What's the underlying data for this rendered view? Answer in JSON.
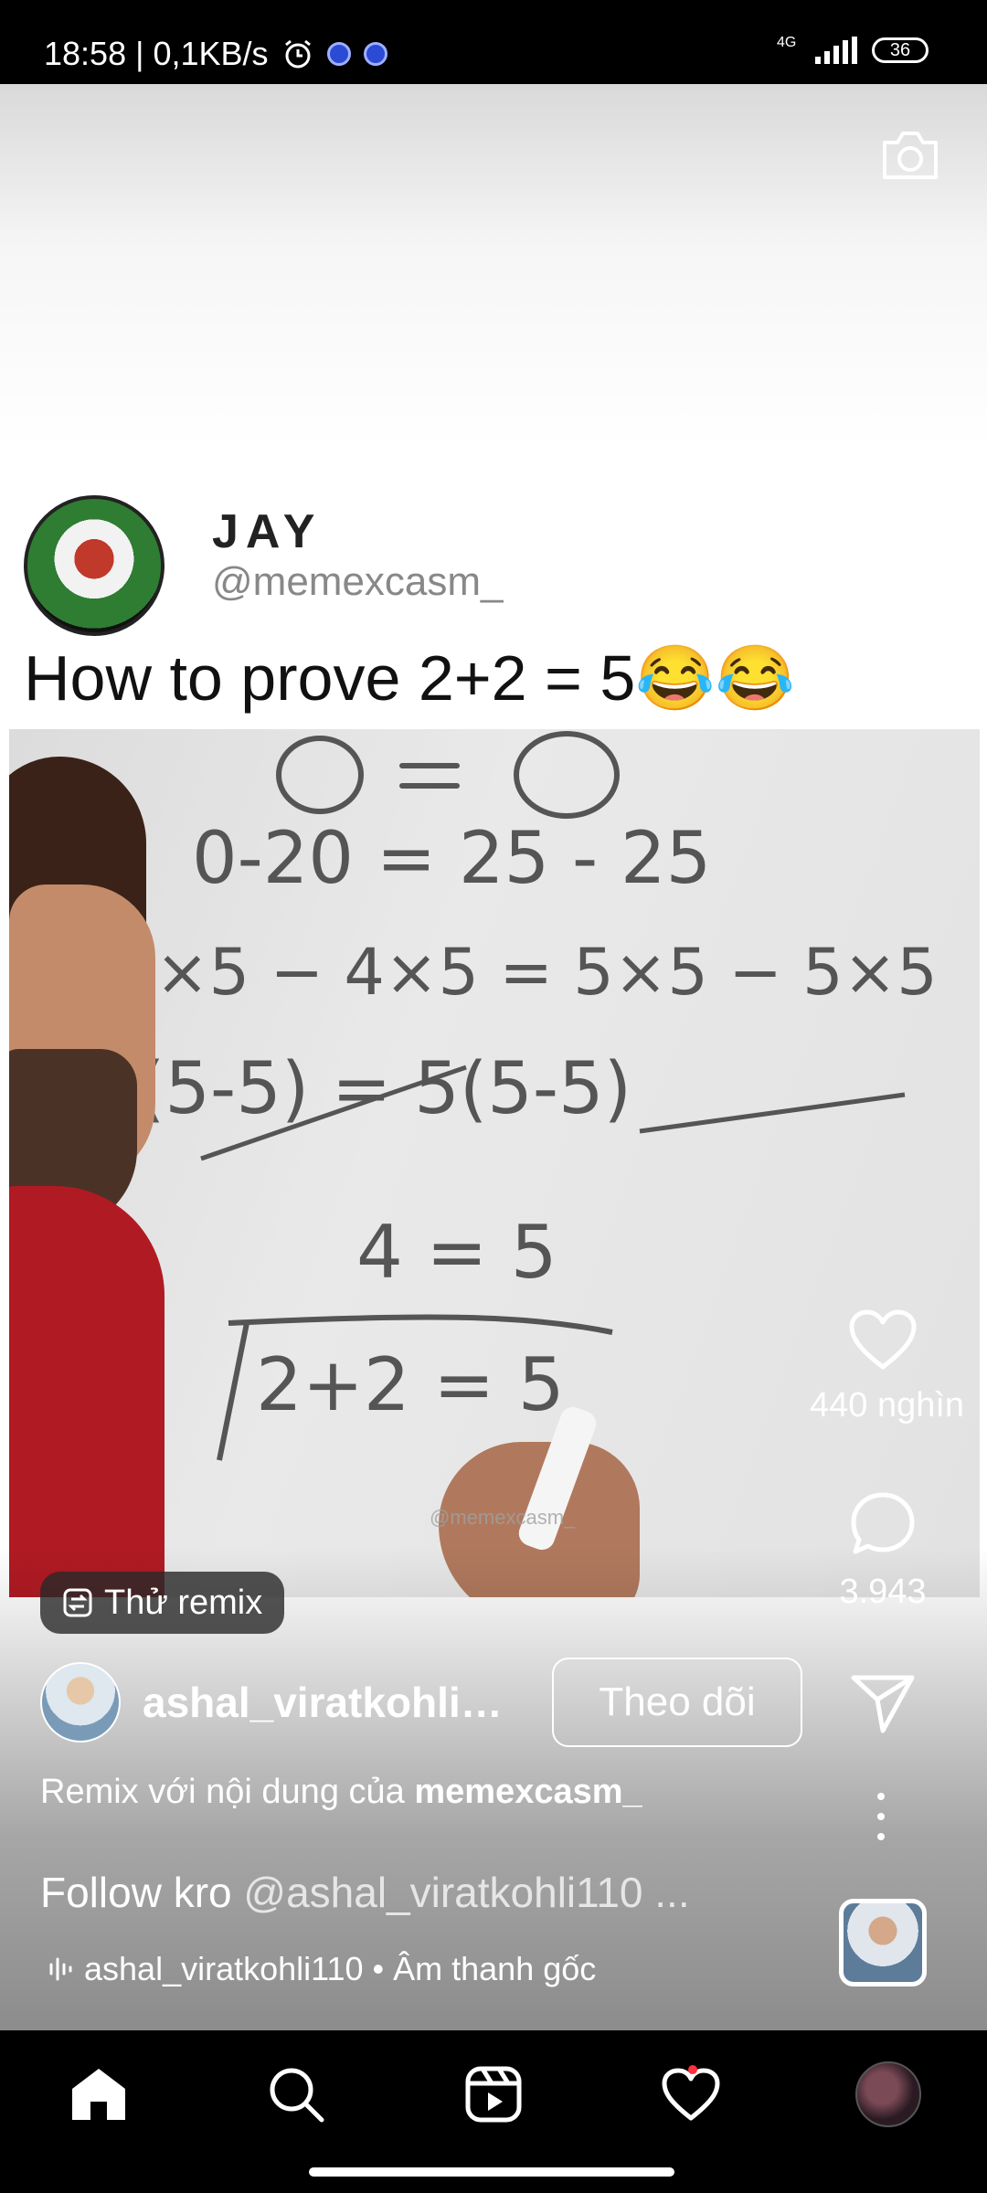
{
  "status_bar": {
    "time_speed": "18:58 | 0,1KB/s",
    "network": "4G",
    "battery": "36"
  },
  "post": {
    "name": "JAY",
    "handle": "@memexcasm_",
    "caption": "How to prove 2+2 = 5😂😂",
    "watermark": "@memexcasm_"
  },
  "whiteboard_lines": [
    "0 = 0",
    "20-20 = 25-25",
    "4×5 − 4×5 = 5×5 − 5×5",
    "4(5-5) = 5(5-5)",
    "4 = 5",
    "2+2 = 5"
  ],
  "actions": {
    "likes": "440 nghìn",
    "comments": "3.943"
  },
  "remix_chip": "Thử remix",
  "author": {
    "username": "ashal_viratkohli110",
    "follow_label": "Theo dõi"
  },
  "remix_line": {
    "prefix": "Remix với nội dung của ",
    "source": "memexcasm_"
  },
  "caption_line": {
    "text": "Follow kro ",
    "mention": "@ashal_viratkohli110 ..."
  },
  "audio_line": "ashal_viratkohli110 • Âm thanh gốc",
  "nav": {
    "items": [
      "home-icon",
      "search-icon",
      "reels-icon",
      "heart-icon",
      "profile-avatar"
    ],
    "notification_color": "#ff3040"
  },
  "colors": {
    "background": "#000000",
    "accent_red": "#ff3040"
  }
}
